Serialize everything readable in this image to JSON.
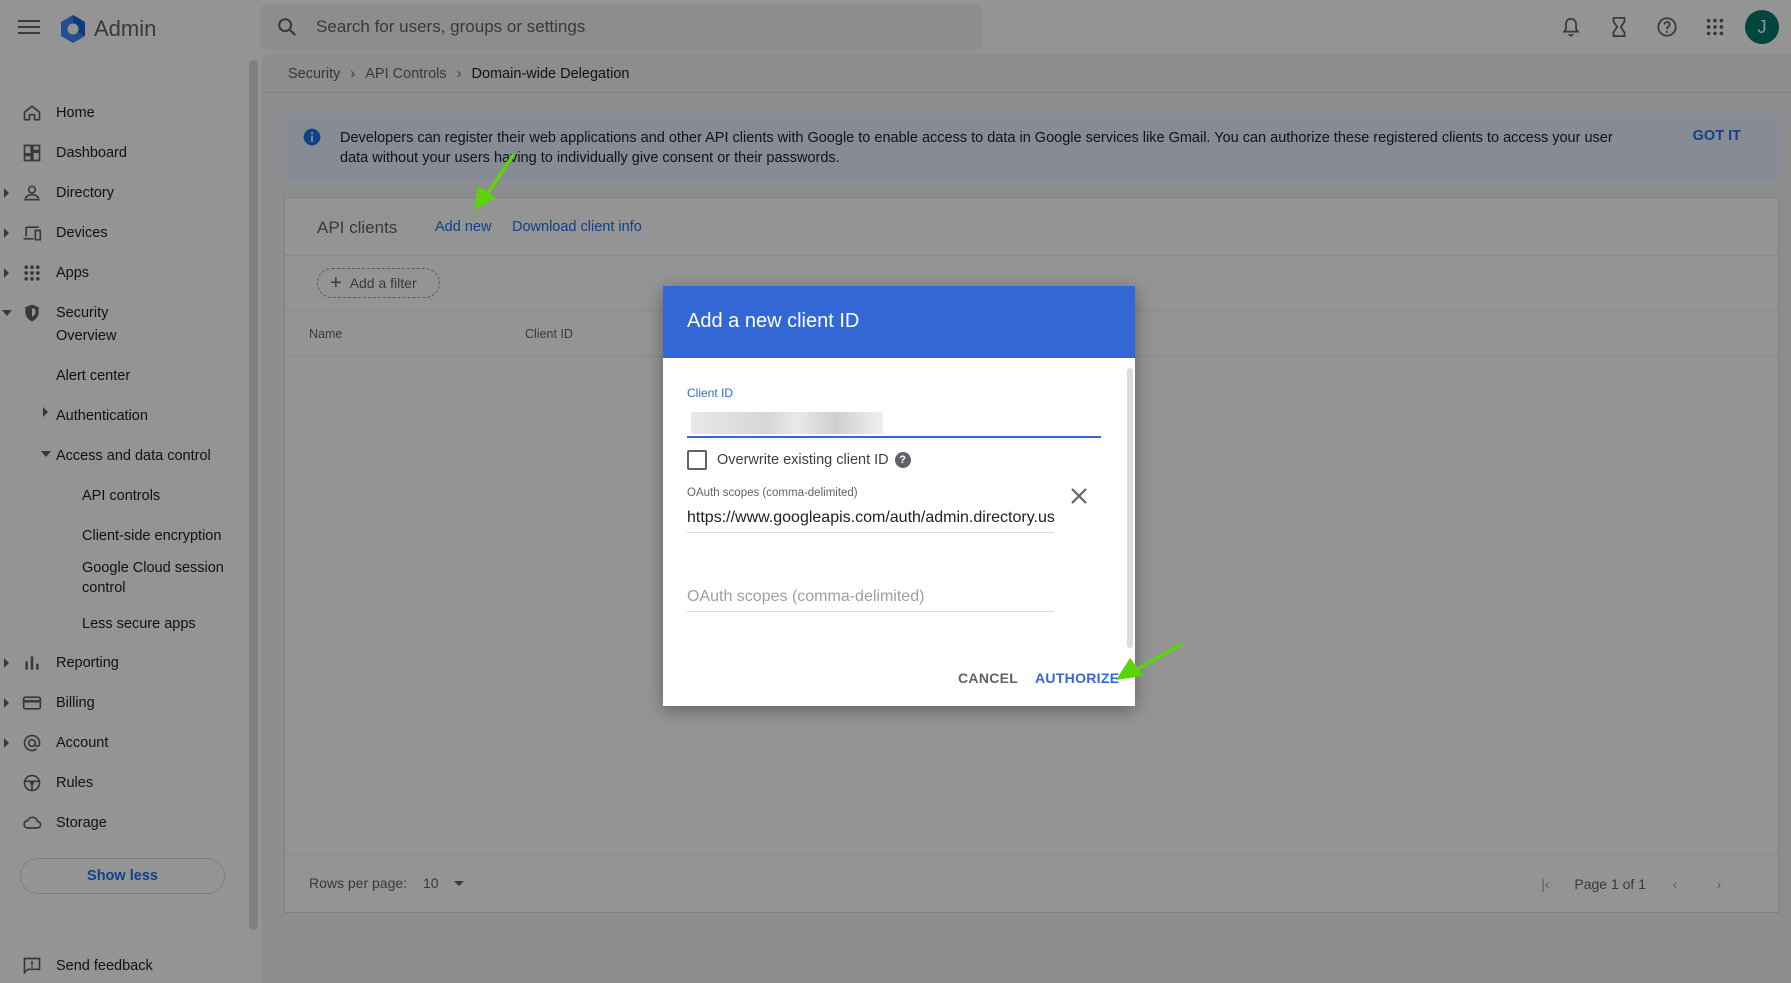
{
  "app": {
    "title": "Admin",
    "avatar_letter": "J"
  },
  "search": {
    "placeholder": "Search for users, groups or settings"
  },
  "topbar_icons": [
    "bell-icon",
    "hourglass-icon",
    "help-icon",
    "apps-grid-icon"
  ],
  "sidebar": {
    "items": [
      {
        "label": "Home",
        "icon": "home-icon"
      },
      {
        "label": "Dashboard",
        "icon": "dashboard-icon"
      },
      {
        "label": "Directory",
        "icon": "person-icon"
      },
      {
        "label": "Devices",
        "icon": "devices-icon"
      },
      {
        "label": "Apps",
        "icon": "apps-icon"
      },
      {
        "label": "Security",
        "icon": "shield-icon"
      },
      {
        "label": "Reporting",
        "icon": "bar-chart-icon"
      },
      {
        "label": "Billing",
        "icon": "credit-card-icon"
      },
      {
        "label": "Account",
        "icon": "at-sign-icon"
      },
      {
        "label": "Rules",
        "icon": "steering-icon"
      },
      {
        "label": "Storage",
        "icon": "cloud-icon"
      }
    ],
    "security_sub": {
      "overview": "Overview",
      "alert_center": "Alert center",
      "authentication": "Authentication",
      "access_and_data_control": "Access and data control",
      "api_controls": "API controls",
      "client_side_encryption": "Client-side encryption",
      "google_cloud_session_control": "Google Cloud session control",
      "less_secure_apps": "Less secure apps"
    },
    "show_less": "Show less",
    "send_feedback": "Send feedback"
  },
  "breadcrumb": {
    "items": [
      "Security",
      "API Controls"
    ],
    "current": "Domain-wide Delegation"
  },
  "banner": {
    "text": "Developers can register their web applications and other API clients with Google to enable access to data in Google services like Gmail. You can authorize these registered clients to access your user data without your users having to individually give consent or their passwords.",
    "action": "GOT IT"
  },
  "card": {
    "title": "API clients",
    "add_new": "Add new",
    "download": "Download client info",
    "filter": "Add a filter",
    "columns": [
      "Name",
      "Client ID"
    ],
    "rows_per_page_label": "Rows per page:",
    "rows_per_page_value": "10",
    "page_text": "Page 1 of 1"
  },
  "dialog": {
    "title": "Add a new client ID",
    "client_id_label": "Client ID",
    "client_id_value": "",
    "overwrite_label": "Overwrite existing client ID",
    "scope_label": "OAuth scopes (comma-delimited)",
    "scope_value": "https://www.googleapis.com/auth/admin.directory.user",
    "scope_placeholder": "OAuth scopes (comma-delimited)",
    "cancel": "CANCEL",
    "authorize": "AUTHORIZE"
  },
  "colors": {
    "accent": "#1a73e8",
    "dialog_header": "#3367d6",
    "banner_bg": "#e8f0fe",
    "annotation_arrow": "#5ad40a"
  }
}
